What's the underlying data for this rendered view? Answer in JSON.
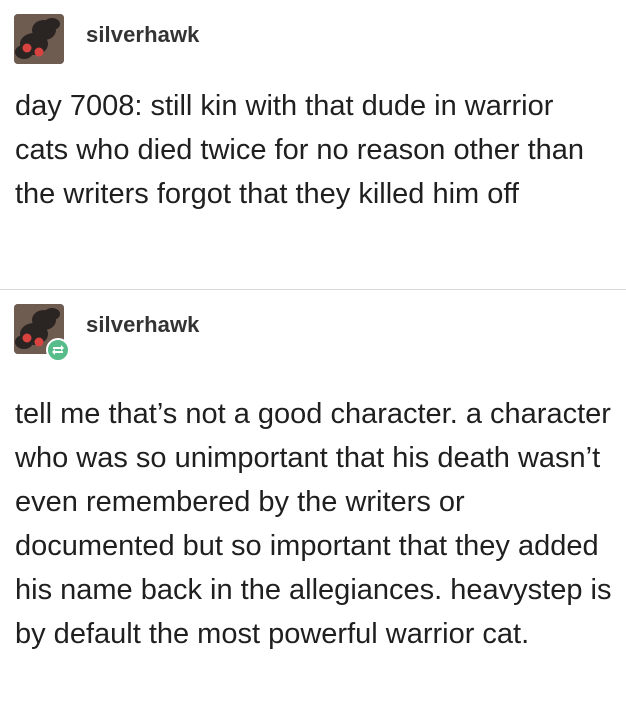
{
  "posts": [
    {
      "username": "silverhawk",
      "avatar_icon": "moth-avatar-icon",
      "is_reblog": false,
      "text": "day 7008: still kin with that dude in warrior cats who died twice for no reason other than the writers forgot that they killed him off"
    },
    {
      "username": "silverhawk",
      "avatar_icon": "moth-avatar-icon",
      "is_reblog": true,
      "reblog_icon": "reblog-icon",
      "text": "tell me that’s not a good character. a character who was so unimportant that his death wasn’t even remembered by the writers or documented but so important that they added his name back in the allegiances. heavystep is by default the most powerful warrior cat."
    }
  ],
  "colors": {
    "avatar_bg": "#6e5c51",
    "reblog_badge": "#56bc8a",
    "text": "#1f1f1f",
    "username": "#333333",
    "divider": "#d9d9d9"
  }
}
